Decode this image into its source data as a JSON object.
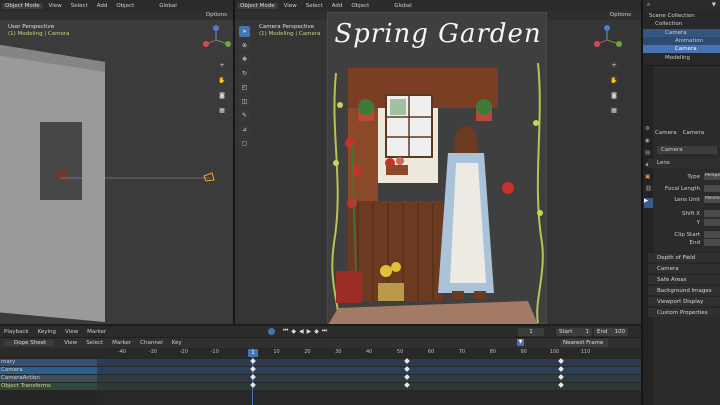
{
  "left_view": {
    "mode": "Object Mode",
    "menu": [
      "View",
      "Select",
      "Add",
      "Object"
    ],
    "orientation": "Global",
    "options": "Options",
    "view_name": "User Perspective",
    "collection_label": "(1) Modeling | Camera"
  },
  "right_view": {
    "mode": "Object Mode",
    "menu": [
      "View",
      "Select",
      "Add",
      "Object"
    ],
    "orientation": "Global",
    "options": "Options",
    "view_name": "Camera Perspective",
    "collection_label": "(1) Modeling | Camera",
    "artwork_title": "Spring Garden"
  },
  "outliner": {
    "items": [
      {
        "label": "Scene Collection"
      },
      {
        "label": "Collection"
      },
      {
        "label": "Camera"
      },
      {
        "label": "Animation"
      },
      {
        "label": "Camera"
      },
      {
        "label": "Modeling"
      }
    ]
  },
  "properties": {
    "object_label": "Camera",
    "object_label2": "Camera",
    "data_name": "Camera",
    "lens_header": "Lens",
    "rows": [
      {
        "label": "Type",
        "value": "Perspe"
      },
      {
        "label": "Focal Length",
        "value": ""
      },
      {
        "label": "Lens Unit",
        "value": "Millime"
      },
      {
        "label": "Shift X",
        "value": ""
      },
      {
        "label": "Y",
        "value": ""
      },
      {
        "label": "Clip Start",
        "value": ""
      },
      {
        "label": "End",
        "value": ""
      }
    ],
    "panels": [
      "Depth of Field",
      "Camera",
      "Safe Areas",
      "Background Images",
      "Viewport Display",
      "Custom Properties"
    ]
  },
  "timeline": {
    "menu": [
      "Playback",
      "Keying",
      "View",
      "Marker"
    ],
    "current_frame": "1",
    "start_label": "Start",
    "start": "1",
    "end_label": "End",
    "end": "100"
  },
  "dopesheet": {
    "mode": "Dope Sheet",
    "menu": [
      "View",
      "Select",
      "Marker",
      "Channel",
      "Key"
    ],
    "interpolation": "Nearest Frame",
    "ticks": [
      "-40",
      "-30",
      "-20",
      "-10",
      "1",
      "10",
      "20",
      "30",
      "40",
      "50",
      "60",
      "70",
      "80",
      "90",
      "100",
      "110"
    ],
    "channels": [
      {
        "label": "mary",
        "color": "#36507a"
      },
      {
        "label": "Camera",
        "color": "#2c5f8f"
      },
      {
        "label": "CameraAction",
        "color": "#3d4f5a"
      },
      {
        "label": "Object Transforms",
        "color": "#2f4a3d"
      }
    ]
  },
  "colors": {
    "accent": "#4772b3",
    "frame_indicator": "#4772b3",
    "keyframe": "#e8e8e8",
    "camera_wire": "#e6b022"
  }
}
